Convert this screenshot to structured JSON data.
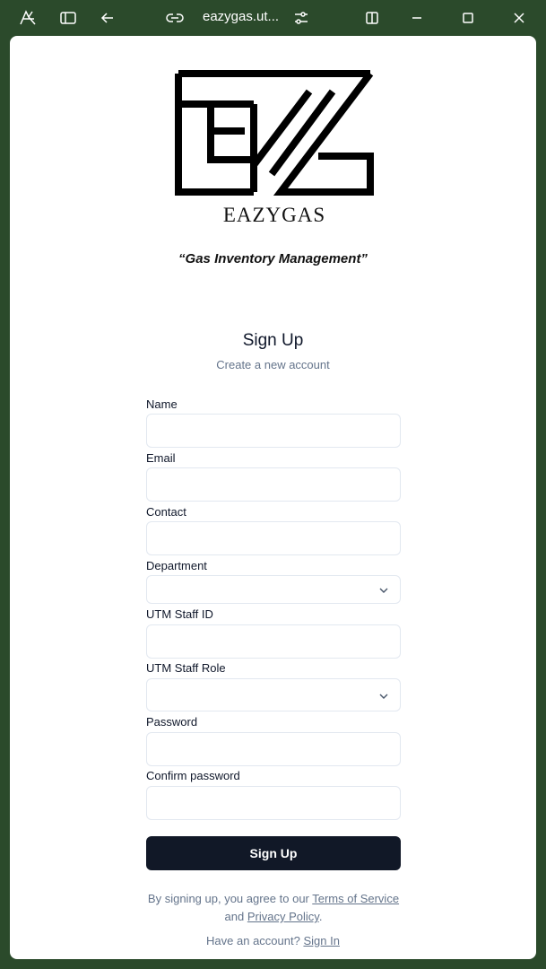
{
  "browser": {
    "url": "eazygas.ut..."
  },
  "brand": {
    "wordmark": "EAZYGAS",
    "tagline": "“Gas Inventory Management”"
  },
  "form": {
    "heading": "Sign Up",
    "subheading": "Create a new account",
    "fields": {
      "name": {
        "label": "Name",
        "value": ""
      },
      "email": {
        "label": "Email",
        "value": ""
      },
      "contact": {
        "label": "Contact",
        "value": ""
      },
      "department": {
        "label": "Department",
        "selected": ""
      },
      "staff_id": {
        "label": "UTM Staff ID",
        "value": ""
      },
      "staff_role": {
        "label": "UTM Staff Role",
        "selected": ""
      },
      "password": {
        "label": "Password",
        "value": ""
      },
      "confirm_password": {
        "label": "Confirm password",
        "value": ""
      }
    },
    "submit_label": "Sign Up",
    "terms": {
      "prefix": "By signing up, you agree to our ",
      "terms_link": "Terms of Service",
      "middle": " and ",
      "privacy_link": "Privacy Policy",
      "suffix": "."
    },
    "signin": {
      "prompt": "Have an account? ",
      "link": "Sign In"
    }
  },
  "colors": {
    "frame": "#2b4a2b",
    "button": "#111827",
    "muted_text": "#64748b",
    "border": "#e2e8f0"
  }
}
